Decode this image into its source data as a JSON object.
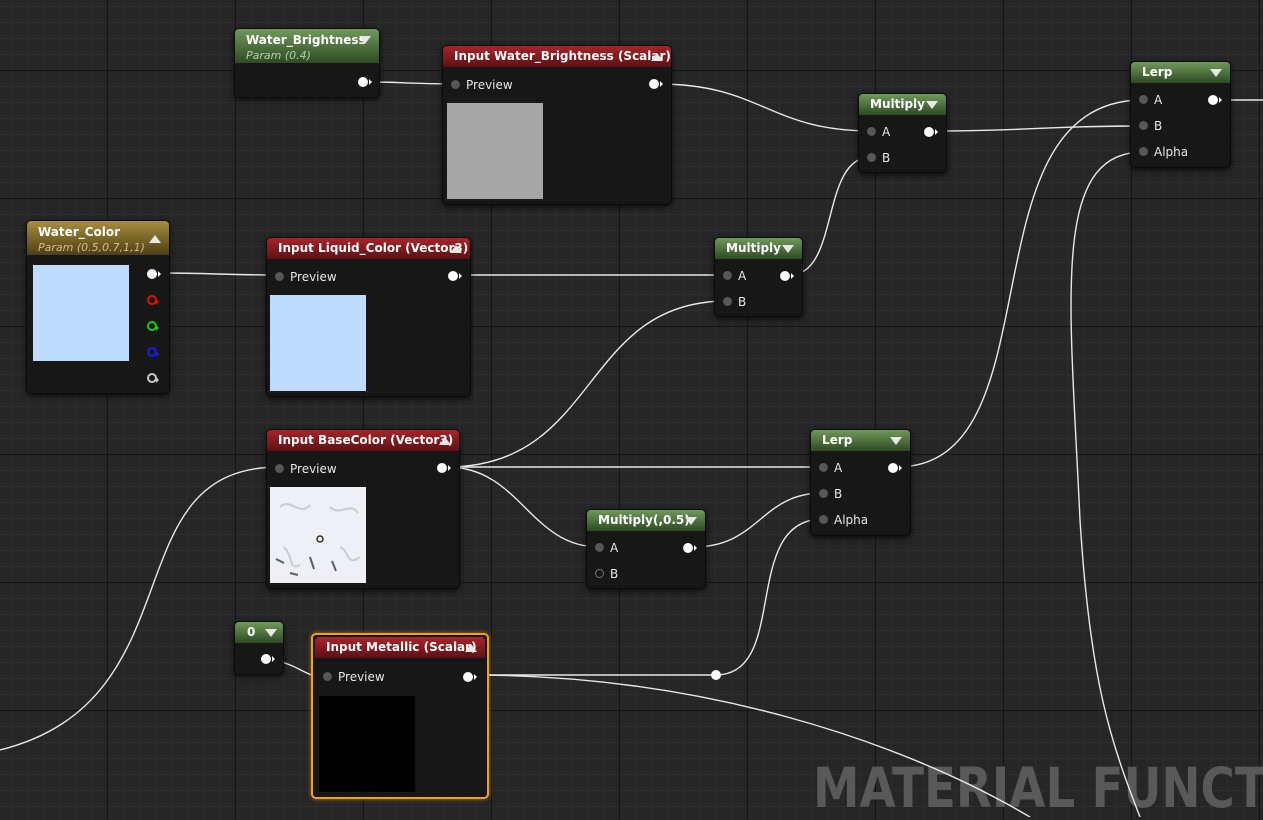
{
  "graph": {
    "watermark": "MATERIAL FUNCT",
    "nodes": {
      "water_brightness": {
        "title": "Water_Brightness",
        "subtitle": "Param (0.4)"
      },
      "input_water_brightness": {
        "title": "Input Water_Brightness (Scalar)",
        "pin": "Preview"
      },
      "water_color": {
        "title": "Water_Color",
        "subtitle": "Param (0.5,0.7,1,1)"
      },
      "input_liquid_color": {
        "title": "Input Liquid_Color (Vector3)",
        "pin": "Preview"
      },
      "input_basecolor": {
        "title": "Input BaseColor (Vector3)",
        "pin": "Preview"
      },
      "constant_zero": {
        "title": "0"
      },
      "input_metallic": {
        "title": "Input Metallic (Scalar)",
        "pin": "Preview"
      },
      "multiply_top": {
        "title": "Multiply",
        "pin_a": "A",
        "pin_b": "B"
      },
      "multiply_mid": {
        "title": "Multiply",
        "pin_a": "A",
        "pin_b": "B"
      },
      "multiply_half": {
        "title": "Multiply(,0.5)",
        "pin_a": "A",
        "pin_b": "B"
      },
      "lerp_lower": {
        "title": "Lerp",
        "pin_a": "A",
        "pin_b": "B",
        "pin_alpha": "Alpha"
      },
      "lerp_upper": {
        "title": "Lerp",
        "pin_a": "A",
        "pin_b": "B",
        "pin_alpha": "Alpha"
      }
    },
    "colors": {
      "preview_brightness": "#a6a6a6",
      "preview_water_color": "#bfdcff",
      "preview_metallic": "#000000",
      "pin_red": "#e01010",
      "pin_green": "#10d010",
      "pin_blue": "#1020e0",
      "pin_gray": "#c8c8c8"
    }
  }
}
